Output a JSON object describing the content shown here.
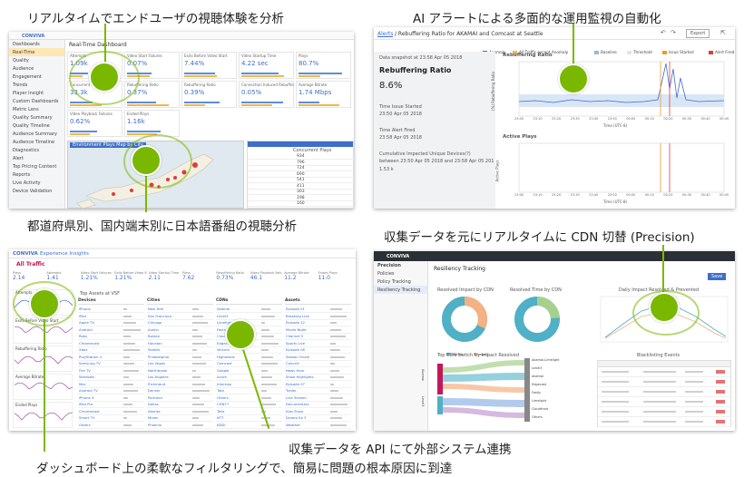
{
  "captions": {
    "top_left": "リアルタイムでエンドユーザの視聴体験を分析",
    "top_right": "AI アラートによる多面的な運用監視の自動化",
    "mid_left": "都道府県別、国内端末別に日本語番組の視聴分析",
    "mid_right": "収集データを元にリアルタイムに CDN 切替 (Precision)",
    "bottom_right": "収集データを API にて外部システム連携",
    "bottom_left": "ダッシュボード上の柔軟なフィルタリングで、簡易に問題の根本原因に到達"
  },
  "panel1": {
    "brand": "CONVIVA",
    "sidebar": [
      "Dashboards",
      "Real-Time",
      "Quality",
      "Audience",
      "Engagement",
      "Trends",
      "Player Insight",
      "Custom Dashboards",
      "Metric Lens",
      "Quality Summary",
      "Quality Timeline",
      "Audience Summary",
      "Audience Timeline",
      "Diagnostics",
      "Alert",
      "Top Pricing Content",
      "Reports",
      "Live Activity",
      "Device Validation"
    ],
    "dashboard_title": "Real-Time Dashboard",
    "metrics": [
      {
        "label": "Attempts",
        "value": "1.09k"
      },
      {
        "label": "Video Start Failures",
        "value": "0.07%"
      },
      {
        "label": "Exits Before Video Start",
        "value": "7.44%"
      },
      {
        "label": "Video Startup Time",
        "value": "4.22 sec"
      },
      {
        "label": "Plays",
        "value": "80.7%"
      },
      {
        "label": "Concurrent Plays",
        "value": "33.3k"
      },
      {
        "label": "Rebuffering Ratio",
        "value": "0.37%"
      },
      {
        "label": "Rebuffering Ratio",
        "value": "0.39%"
      },
      {
        "label": "Connection Induced Rebuffering Ratio",
        "value": "0.05%"
      },
      {
        "label": "Average Bitrate",
        "value": "1.74 Mbps"
      },
      {
        "label": "Video Playback Failures",
        "value": "0.62%"
      },
      {
        "label": "Ended Plays",
        "value": "1.16k"
      }
    ],
    "map_title": "Environment Plays Map by City",
    "table_col": "Concurrent Plays",
    "table_vals": [
      "934",
      "796",
      "724",
      "690",
      "541",
      "411",
      "303",
      "198",
      "160"
    ]
  },
  "panel2": {
    "breadcrumb_link": "Alerts",
    "breadcrumb_rest": "/ Rebuffering Ratio for AKAMAI and Comcast at Seattle",
    "export": "Export",
    "legend": [
      "Anomaly",
      "All Traffic except Anomaly",
      "Baseline",
      "Threshold",
      "Issue Started",
      "Alert Fired"
    ],
    "snapshot": "Data snapshot at 23:58 Apr 05 2018",
    "metric_name": "Rebuffering Ratio",
    "metric_value": "8.6%",
    "issue_started_label": "Time Issue Started",
    "issue_started": "23:50 Apr 05 2018",
    "alert_fired_label": "Time Alert Fired",
    "alert_fired": "23:58 Apr 05 2018",
    "impacted_label": "Cumulative Impacted Unique Devices(?)",
    "impacted_range": "between 23:50 Apr 05 2018 and 23:58 Apr 05 2018",
    "impacted_value": "1.53 k",
    "chart1_title": "Rebuffering Ratio",
    "chart1_ylabel": "(%) Rebuffering Ratio",
    "chart2_title": "Active Plays",
    "chart2_ylabel": "Active Plays",
    "xlabel": "Time (UTC-8)",
    "xticks": [
      "23:00",
      "23:10",
      "23:20",
      "23:30",
      "23:40",
      "23:50",
      "00:00",
      "00:10",
      "00:20",
      "00:30",
      "00:40",
      "00:45"
    ]
  },
  "panel3": {
    "brand": "CONVIVA",
    "subtitle": "Experience Insights",
    "filter": "All Traffic",
    "kpis": [
      {
        "label": "Plays",
        "value": "2.14"
      },
      {
        "label": "Attempts",
        "value": "1.41"
      },
      {
        "label": "Video Start Failures",
        "value": "1.21%"
      },
      {
        "label": "Exits Before Video Start",
        "value": "1.21%"
      },
      {
        "label": "Video Startup Time",
        "value": "2.11"
      },
      {
        "label": "Plays",
        "value": "7.62"
      },
      {
        "label": "Rebuffering Ratio",
        "value": "0.73%"
      },
      {
        "label": "Video Playback Failures",
        "value": "46.1"
      },
      {
        "label": "Average Bitrate",
        "value": "11.2"
      },
      {
        "label": "Ended Plays",
        "value": "11.0"
      }
    ],
    "left_charts": [
      "Attempts",
      "Exits Before Video Start",
      "Rebuffering Ratio",
      "Average Bitrate",
      "Ended Plays"
    ],
    "table_title": "Top Assets at VSF",
    "columns": [
      "Devices",
      "Cities",
      "CDNs",
      "Assets"
    ],
    "device_rows": [
      "iPhone",
      "iPad",
      "Apple TV",
      "Android",
      "Roku",
      "Chromecast",
      "Xbox",
      "PlayStation 4",
      "Samsung TV",
      "Fire TV",
      "Windows",
      "Mac",
      "Android TV",
      "iPhone X",
      "iPad Pro",
      "Chromecast",
      "Smart TV",
      "Others"
    ],
    "city_rows": [
      "New York",
      "San Francisco",
      "Chicago",
      "Austin",
      "Boston",
      "Houston",
      "Seattle",
      "Philadelphia",
      "Las Vegas",
      "Northbrook",
      "Los Angeles",
      "Richmond",
      "Denver",
      "Portland",
      "Dallas",
      "Atlanta",
      "Miami",
      "Phoenix"
    ],
    "cdn_rows": [
      "Akamai",
      "Level3",
      "Limelight",
      "Fastly",
      "Cloudfront",
      "Edgecast",
      "Verizon",
      "Highwinds",
      "Comcast",
      "Google",
      "Azure",
      "Internap",
      "Tata",
      "Others",
      "CDN77",
      "Telia",
      "NTT",
      "KDDI"
    ],
    "asset_rows": [
      "Episode 01",
      "Breaking Live",
      "Episode 12",
      "Movie Night",
      "Channel 5",
      "Sports Live",
      "Episode 08",
      "Season Finale",
      "Concert",
      "News Hour",
      "Show Highlights",
      "Episode 07",
      "Trailer",
      "Live Stream",
      "Documentary",
      "Kids Show",
      "Drama Ep 3",
      "Weather"
    ]
  },
  "panel4": {
    "brand": "CONVIVA",
    "sidebar": [
      "Precision",
      "Policies",
      "Policy Tracking",
      "Resiliency Tracking"
    ],
    "title": "Resiliency Tracking",
    "button": "Save",
    "donut1_title": "Resolved Impact by CDN",
    "donut2_title": "Resolved Time by CDN",
    "line_title": "Daily Impact Resolved & Prevented",
    "sankey_title": "Top CDN Switch by Impact Resolved",
    "events_title": "Blacklisting Events",
    "donut_legend": [
      "Akamai",
      "Level3"
    ],
    "sankey_left": [
      "Akamai",
      "Level3"
    ],
    "sankey_right": [
      "Akamai-Limelight",
      "Level3",
      "Akamai",
      "Edgecast",
      "Fastly",
      "Limelight",
      "Cloudfront",
      "Others"
    ]
  },
  "colors": {
    "accent": "#7ab800",
    "conviva_blue": "#3d6ec9",
    "alert_orange": "#f09a2a",
    "teal": "#4fb0c6",
    "peach": "#f4b183"
  }
}
